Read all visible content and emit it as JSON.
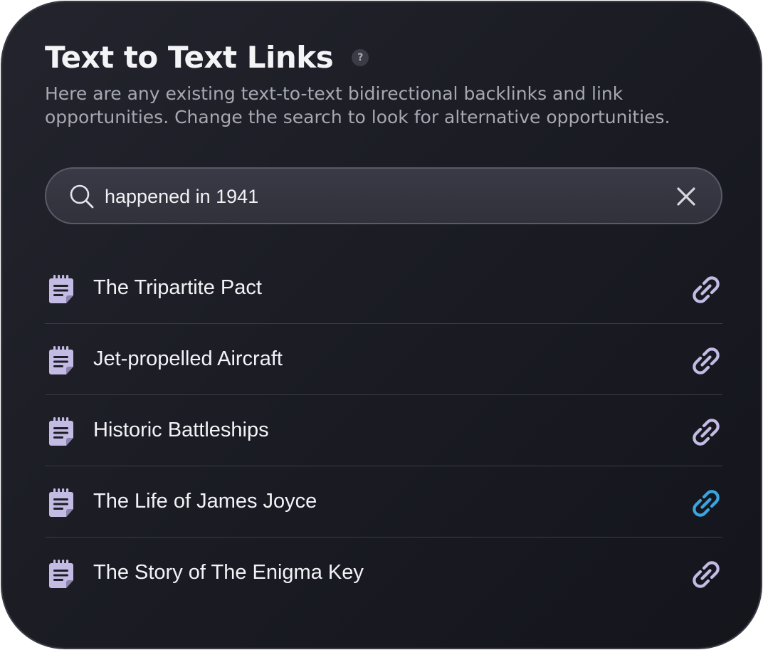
{
  "header": {
    "title": "Text to Text Links",
    "help_label": "?"
  },
  "subtitle": "Here are any existing text-to-text bidirectional backlinks and link opportunities. Change the search to look for alternative opportunities.",
  "search": {
    "value": "happened in 1941",
    "placeholder": ""
  },
  "items": [
    {
      "label": "The Tripartite Pact",
      "linked": false
    },
    {
      "label": "Jet-propelled Aircraft",
      "linked": false
    },
    {
      "label": "Historic Battleships",
      "linked": false
    },
    {
      "label": "The Life of James Joyce",
      "linked": true
    },
    {
      "label": "The Story of The Enigma Key",
      "linked": false
    }
  ],
  "icons": {
    "search": "search-icon",
    "clear": "close-icon",
    "document": "note-document-icon",
    "link": "link-icon"
  },
  "colors": {
    "background": "#1c1d25",
    "icon_default": "#c3bbe4",
    "icon_active": "#3aa5e0",
    "text_primary": "#f3f3f7",
    "text_secondary": "#a7a8b3"
  }
}
